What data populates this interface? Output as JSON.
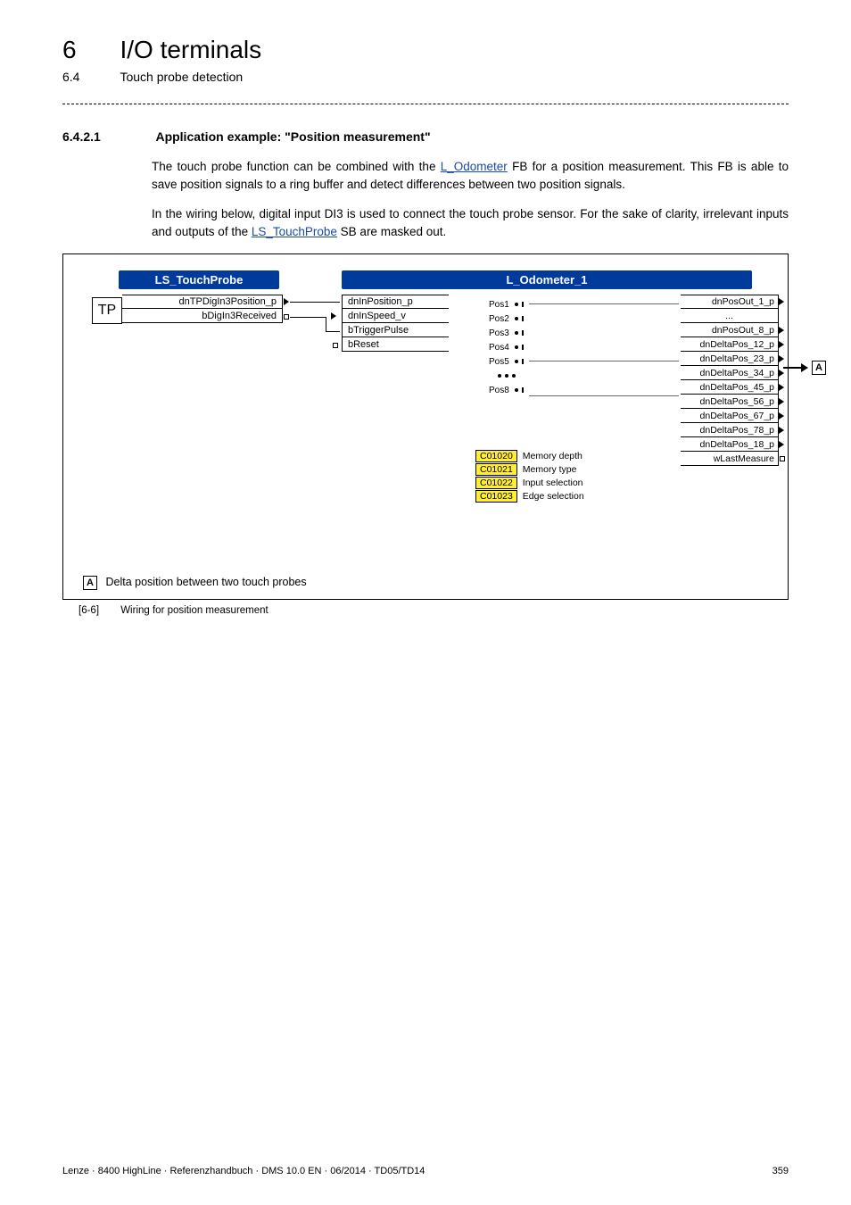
{
  "chapter": {
    "num": "6",
    "title": "I/O terminals"
  },
  "subsection": {
    "num": "6.4",
    "title": "Touch probe detection"
  },
  "section": {
    "num": "6.4.2.1",
    "title": "Application example: \"Position measurement\""
  },
  "paras": {
    "p1a": "The touch probe function can be combined with the ",
    "p1_link": "L_Odometer",
    "p1b": " FB for a position measurement. This FB is able to save position signals to a ring buffer and detect differences between two position signals.",
    "p2a": "In the wiring below, digital input DI3 is used to connect the touch probe sensor. For the sake of clarity, irrelevant inputs and outputs of the ",
    "p2_link": "LS_TouchProbe",
    "p2b": " SB are masked out."
  },
  "diagram": {
    "ls_block": {
      "title": "LS_TouchProbe",
      "tp": "TP",
      "out1": "dnTPDigIn3Position_p",
      "out2": "bDigIn3Received"
    },
    "od_block": {
      "title": "L_Odometer_1",
      "ins": [
        "dnInPosition_p",
        "dnInSpeed_v",
        "bTriggerPulse",
        "bReset"
      ],
      "mid": [
        "Pos1",
        "Pos2",
        "Pos3",
        "Pos4",
        "Pos5",
        "",
        "Pos8"
      ],
      "outs": [
        "dnPosOut_1_p",
        "...",
        "dnPosOut_8_p",
        "dnDeltaPos_12_p",
        "dnDeltaPos_23_p",
        "dnDeltaPos_34_p",
        "dnDeltaPos_45_p",
        "dnDeltaPos_56_p",
        "dnDeltaPos_67_p",
        "dnDeltaPos_78_p",
        "dnDeltaPos_18_p",
        "wLastMeasure"
      ],
      "params": [
        {
          "code": "C01020",
          "label": "Memory depth"
        },
        {
          "code": "C01021",
          "label": "Memory type"
        },
        {
          "code": "C01022",
          "label": "Input selection"
        },
        {
          "code": "C01023",
          "label": "Edge selection"
        }
      ],
      "a_label": "A"
    },
    "legend": {
      "a_label": "A",
      "text": "Delta position between two touch probes"
    },
    "caption_num": "[6-6]",
    "caption_text": "Wiring for position measurement"
  },
  "footer": {
    "left": "Lenze · 8400 HighLine · Referenzhandbuch · DMS 10.0 EN · 06/2014 · TD05/TD14",
    "page": "359"
  },
  "chart_data": null
}
